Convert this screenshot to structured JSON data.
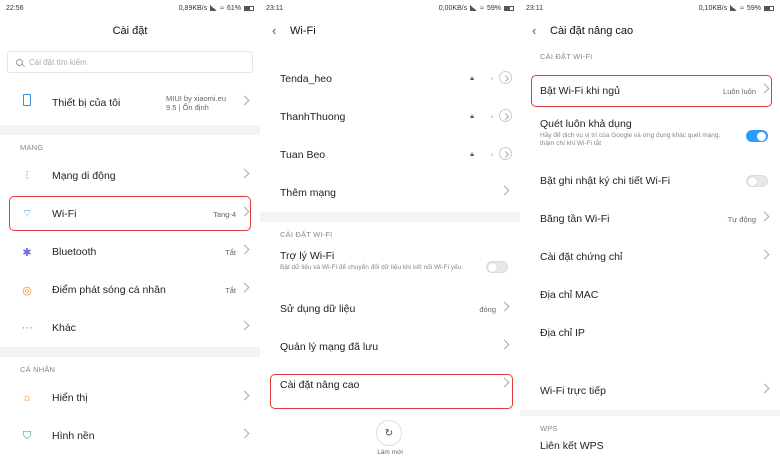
{
  "panel1": {
    "status": {
      "time": "22:56",
      "speed": "0,89KB/s",
      "battery": "61%"
    },
    "title": "Cài đặt",
    "search_placeholder": "Cài đặt tìm kiếm",
    "device": {
      "label": "Thiết bị của tôi",
      "value": "MIUI by xiaomi.eu 9.5 | Ổn định"
    },
    "section_network": "MẠNG",
    "items": [
      {
        "label": "Mạng di động",
        "value": ""
      },
      {
        "label": "Wi-Fi",
        "value": "Tang-4"
      },
      {
        "label": "Bluetooth",
        "value": "Tắt"
      },
      {
        "label": "Điểm phát sóng cá nhân",
        "value": "Tắt"
      },
      {
        "label": "Khác",
        "value": ""
      }
    ],
    "section_personal": "CÁ NHÂN",
    "personal_items": [
      {
        "label": "Hiển thị"
      },
      {
        "label": "Hình nền"
      }
    ]
  },
  "panel2": {
    "status": {
      "time": "23:11",
      "speed": "0,00KB/s",
      "battery": "59%"
    },
    "title": "Wi-Fi",
    "networks": [
      {
        "label": "Tenda_heo"
      },
      {
        "label": "ThanhThuong"
      },
      {
        "label": "Tuan Beo"
      }
    ],
    "add_network": "Thêm mạng",
    "section_settings": "CÀI ĐẶT WI-FI",
    "assistant": {
      "label": "Trợ lý Wi-Fi",
      "desc": "Bật dữ liệu và Wi-Fi để chuyển đổi dữ liệu khi kết nối Wi-Fi yếu."
    },
    "data_usage": {
      "label": "Sử dụng dữ liệu",
      "value": "đóng"
    },
    "saved": "Quản lý mạng đã lưu",
    "advanced": "Cài đặt nâng cao",
    "refresh_label": "Làm mới"
  },
  "panel3": {
    "status": {
      "time": "23:11",
      "speed": "0,10KB/s",
      "battery": "59%"
    },
    "title": "Cài đặt nâng cao",
    "section_settings": "CÀI ĐẶT WI-FI",
    "sleep": {
      "label": "Bật Wi-Fi khi ngủ",
      "value": "Luôn luôn"
    },
    "scan": {
      "label": "Quét luôn khả dụng",
      "desc": "Hãy để dịch vụ vị trí của Google và ứng dụng khác quét mạng, thậm chí khi Wi-Fi tắt"
    },
    "log": {
      "label": "Bật ghi nhật ký chi tiết Wi-Fi"
    },
    "band": {
      "label": "Băng tần Wi-Fi",
      "value": "Tự động"
    },
    "cert": {
      "label": "Cài đặt chứng chỉ"
    },
    "mac": {
      "label": "Địa chỉ MAC"
    },
    "ip": {
      "label": "Địa chỉ IP"
    },
    "direct": {
      "label": "Wi-Fi trực tiếp"
    },
    "section_wps": "WPS",
    "wps_partial": "Liên kết WPS"
  },
  "colors": {
    "highlight": "#e03a3a",
    "toggle_on": "#2a9dfb",
    "wifi_icon": "#3b8ede"
  }
}
